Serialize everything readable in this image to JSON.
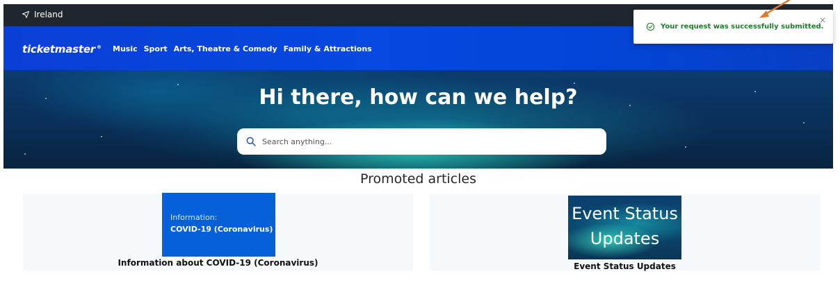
{
  "topbar": {
    "location": "Ireland",
    "location_icon": "navigation-arrow-icon"
  },
  "header": {
    "logo": "ticketmaster",
    "logo_mark": "®",
    "nav": [
      "Music",
      "Sport",
      "Arts, Theatre & Comedy",
      "Family & Attractions"
    ]
  },
  "hero": {
    "heading": "Hi there, how can we help?",
    "search_placeholder": "Search anything...",
    "search_icon": "search-icon"
  },
  "promoted": {
    "title": "Promoted articles",
    "articles": [
      {
        "thumb_line1": "Information:",
        "thumb_line2": "COVID-19 (Coronavirus)",
        "caption": "Information about COVID-19 (Coronavirus)"
      },
      {
        "thumb_line1": "Event Status",
        "thumb_line2": "Updates",
        "caption": "Event Status Updates"
      }
    ]
  },
  "toast": {
    "message": "Your request was successfully submitted.",
    "close": "×",
    "icon": "check-circle-icon"
  },
  "colors": {
    "brand_blue": "#0648e0",
    "topbar": "#1f262d",
    "success_green": "#1e7a2d",
    "annotation_arrow": "#e07a2b"
  }
}
